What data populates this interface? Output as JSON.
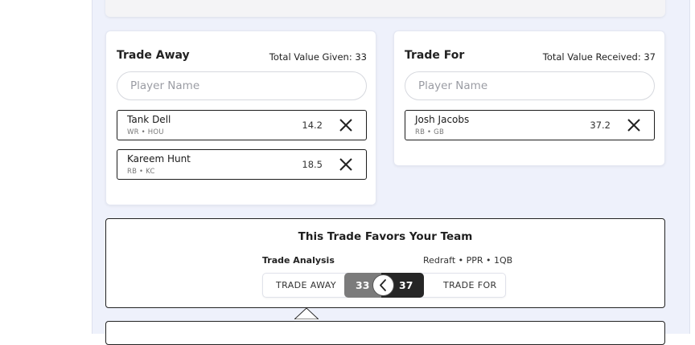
{
  "trade_away": {
    "title": "Trade Away",
    "total_label": "Total Value Given: 33",
    "search_placeholder": "Player Name",
    "players": [
      {
        "name": "Tank Dell",
        "meta": "WR • HOU",
        "value": "14.2"
      },
      {
        "name": "Kareem Hunt",
        "meta": "RB • KC",
        "value": "18.5"
      }
    ]
  },
  "trade_for": {
    "title": "Trade For",
    "total_label": "Total Value Received: 37",
    "search_placeholder": "Player Name",
    "players": [
      {
        "name": "Josh Jacobs",
        "meta": "RB • GB",
        "value": "37.2"
      }
    ]
  },
  "analysis": {
    "title": "This Trade Favors Your Team",
    "label": "Trade Analysis",
    "settings": "Redraft • PPR • 1QB",
    "away_label": "TRADE AWAY",
    "away_value": "33",
    "for_label": "TRADE FOR",
    "for_value": "37",
    "knob_icon": "chevron-left-icon"
  },
  "colors": {
    "background": "#eef1fb",
    "away_value_bg": "#7b7b7b",
    "for_value_bg": "#262626",
    "border_dark": "#1c1c1c"
  }
}
